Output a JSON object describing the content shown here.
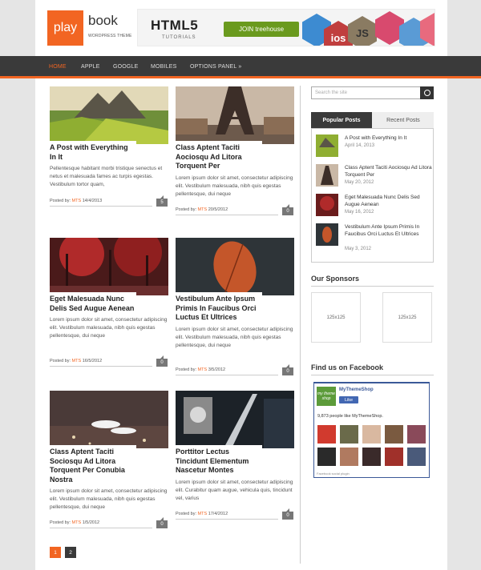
{
  "brand": {
    "logo_box": "play",
    "logo_word": "book",
    "tagline": "WORDPRESS THEME",
    "accent": "#f26522"
  },
  "banner": {
    "title": "HTML5",
    "subtitle": "TUTORIALS",
    "button": "JOIN treehouse",
    "hex1": "ios",
    "hex2": "JS"
  },
  "nav": {
    "items": [
      "HOME",
      "APPLE",
      "GOOGLE",
      "MOBILES",
      "OPTIONS PANEL »"
    ]
  },
  "posts": [
    {
      "title": "A Post with Everything In It",
      "excerpt": "Pellentesque habitant morbi tristique senectus et netus et malesuada fames ac turpis egestas. Vestibulum tortor quam,",
      "meta_prefix": "Posted by:",
      "author": "MTS",
      "date": "14/4/2013",
      "comments": "5"
    },
    {
      "title": "Class Aptent Taciti Aociosqu Ad Litora Torquent Per",
      "excerpt": "Lorem ipsum dolor sit amet, consectetur adipiscing elit. Vestibulum malesuada, nibh quis egestas pellentesque, dui neque",
      "meta_prefix": "Posted by:",
      "author": "MTS",
      "date": "20/5/2012",
      "comments": "0"
    },
    {
      "title": "Eget Malesuada Nunc Delis Sed Augue Aenean",
      "excerpt": "Lorem ipsum dolor sit amet, consectetur adipiscing elit. Vestibulum malesuada, nibh quis egestas pellentesque, dui neque",
      "meta_prefix": "Posted by:",
      "author": "MTS",
      "date": "16/5/2012",
      "comments": "0"
    },
    {
      "title": "Vestibulum Ante Ipsum Primis In Faucibus Orci Luctus Et Ultrices",
      "excerpt": "Lorem ipsum dolor sit amet, consectetur adipiscing elit. Vestibulum malesuada, nibh quis egestas pellentesque, dui neque",
      "meta_prefix": "Posted by:",
      "author": "MTS",
      "date": "3/5/2012",
      "comments": "0"
    },
    {
      "title": "Class Aptent Taciti Sociosqu Ad Litora Torquent Per Conubia Nostra",
      "excerpt": "Lorem ipsum dolor sit amet, consectetur adipiscing elit. Vestibulum malesuada, nibh quis egestas pellentesque, dui neque",
      "meta_prefix": "Posted by:",
      "author": "MTS",
      "date": "1/5/2012",
      "comments": "0"
    },
    {
      "title": "Porttitor Lectus Tincidunt Elementum Nascetur Montes",
      "excerpt": "Lorem ipsum dolor sit amet, consectetur adipiscing elit. Curabitur quam augue, vehicula quis, tincidunt vel, varius",
      "meta_prefix": "Posted by:",
      "author": "MTS",
      "date": "17/4/2012",
      "comments": "0"
    }
  ],
  "pagination": [
    "1",
    "2"
  ],
  "sidebar": {
    "search_placeholder": "Search the site",
    "tabs": [
      "Popular Posts",
      "Recent Posts"
    ],
    "popular": [
      {
        "title": "A Post with Everything In It",
        "date": "April 14, 2013"
      },
      {
        "title": "Class Aptent Taciti Aociosqu Ad Litora Torquent Per",
        "date": "May 20, 2012"
      },
      {
        "title": "Eget Malesuada Nunc Delis Sed Augue Aenean",
        "date": "May 16, 2012"
      },
      {
        "title": "Vestibulum Ante Ipsum Primis In Faucibus Orci Luctus Et Ultrices",
        "date": "May 3, 2012"
      }
    ],
    "sponsors_title": "Our Sponsors",
    "ads": [
      "125x125",
      "125x125"
    ],
    "facebook_title": "Find us on Facebook",
    "fb": {
      "logo": "my theme shop",
      "name": "MyThemeShop",
      "like": "Like",
      "count": "9,873 people like MyThemeShop.",
      "footer": "Facebook social plugin"
    }
  }
}
